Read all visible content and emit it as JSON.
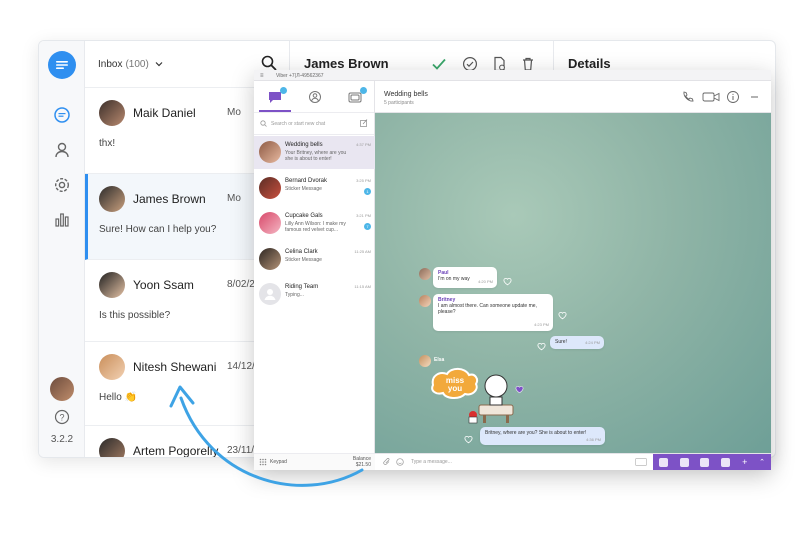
{
  "colors": {
    "accent_blue": "#2f8ff0",
    "viber_purple": "#7d52c6",
    "badge_blue": "#4db6e8"
  },
  "back_app": {
    "version": "3.2.2",
    "inbox": {
      "title": "Inbox",
      "count": "(100)"
    },
    "conversations": [
      {
        "name": "Maik Daniel",
        "date": "Mo",
        "message": "thx!"
      },
      {
        "name": "James Brown",
        "date": "Mo",
        "message": "Sure! How can I help you?"
      },
      {
        "name": "Yoon Ssam",
        "date": "8/02/2",
        "message": "Is this possible?"
      },
      {
        "name": "Nitesh Shewani",
        "date": "14/12/2",
        "message": "Hello 👏"
      },
      {
        "name": "Artem Pogorelly",
        "date": "23/11/2",
        "message": ""
      }
    ],
    "chat_title": "James Brown",
    "details_title": "Details"
  },
  "viber": {
    "window_title": "Viber +7(Л-49562367",
    "search_placeholder": "Search or start new chat",
    "chats": [
      {
        "name": "Wedding bells",
        "preview": "Your Britney, where are you she is about to enter!",
        "time": "4:37 PM",
        "unread": ""
      },
      {
        "name": "Bernard Dvorak",
        "preview": "Sticker Message",
        "time": "3:25 PM",
        "unread": "1"
      },
      {
        "name": "Cupcake Gals",
        "preview": "Lilly Ann Wilson: I make my famous red velvet cup...",
        "time": "3:21 PM",
        "unread": "7"
      },
      {
        "name": "Celina Clark",
        "preview": "Sticker Message",
        "time": "11:25 AM",
        "unread": ""
      },
      {
        "name": "Riding Team",
        "preview": "Typing...",
        "time": "11:15 AM",
        "unread": ""
      }
    ],
    "keypad_label": "Keypad",
    "balance_label": "Balance",
    "balance_value": "$21.50",
    "chat": {
      "title": "Wedding bells",
      "subtitle": "5 participants",
      "input_placeholder": "Type a message...",
      "messages": [
        {
          "sender": "Paul",
          "text": "I'm on my way",
          "time": "4:20 PM"
        },
        {
          "sender": "Britney",
          "text": "I am almost there. Can someone update me, please?",
          "time": "4:23 PM"
        },
        {
          "sender": "",
          "text": "Sure!",
          "time": "4:24 PM"
        },
        {
          "sender": "Elsa",
          "text": "",
          "time": ""
        },
        {
          "sender": "",
          "text": "Britney, where are you? She is about to enter!",
          "time": "4:36 PM"
        }
      ],
      "sticker_text": "miss you"
    }
  }
}
